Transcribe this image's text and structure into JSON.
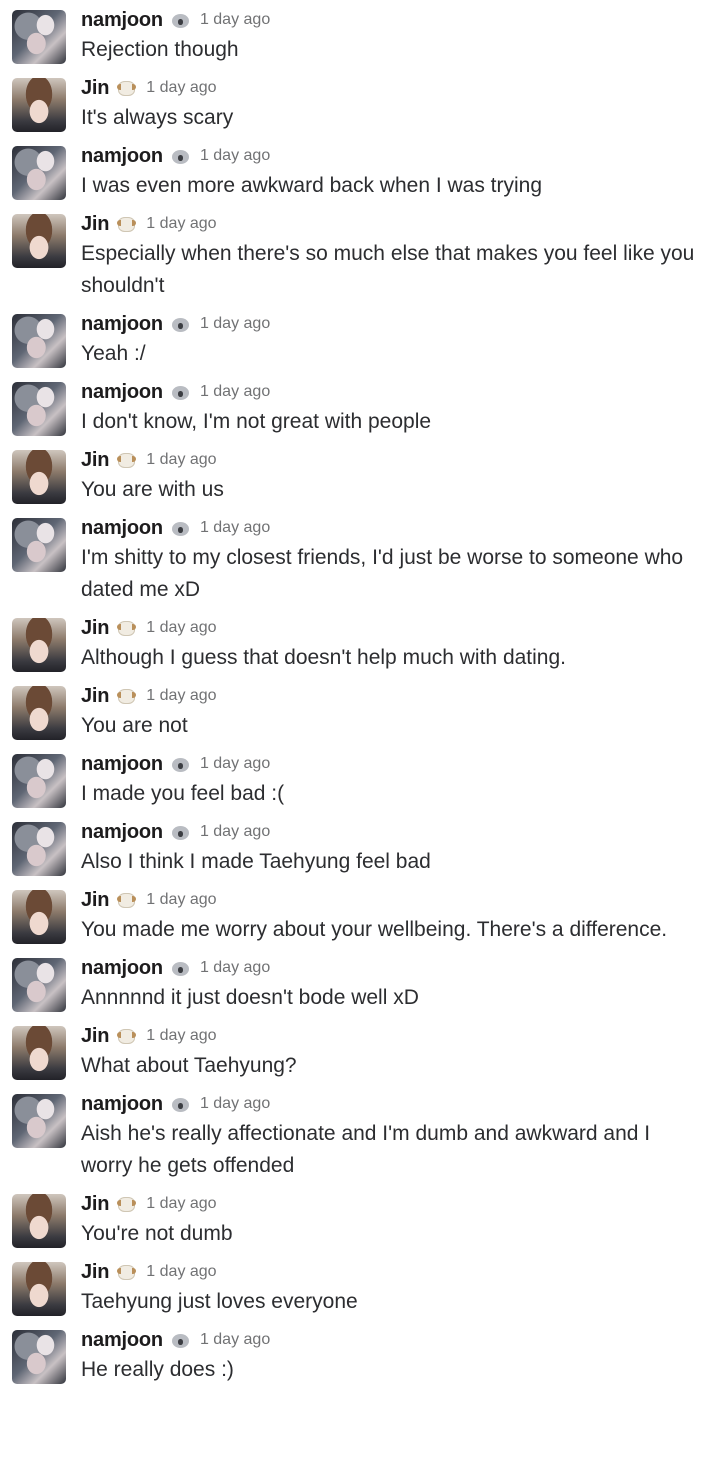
{
  "users": {
    "namjoon": {
      "name": "namjoon",
      "emoji": "koala-icon"
    },
    "jin": {
      "name": "Jin",
      "emoji": "sheep-icon"
    }
  },
  "messages": [
    {
      "user": "namjoon",
      "name": "namjoon",
      "time": "1 day ago",
      "text": "Rejection though"
    },
    {
      "user": "jin",
      "name": "Jin",
      "time": "1 day ago",
      "text": "It's always scary"
    },
    {
      "user": "namjoon",
      "name": "namjoon",
      "time": "1 day ago",
      "text": "I was even more awkward back when I was trying"
    },
    {
      "user": "jin",
      "name": "Jin",
      "time": "1 day ago",
      "text": "Especially when there's so much else that makes you feel like you shouldn't"
    },
    {
      "user": "namjoon",
      "name": "namjoon",
      "time": "1 day ago",
      "text": "Yeah :/"
    },
    {
      "user": "namjoon",
      "name": "namjoon",
      "time": "1 day ago",
      "text": "I don't know, I'm not great with people"
    },
    {
      "user": "jin",
      "name": "Jin",
      "time": "1 day ago",
      "text": "You are with us"
    },
    {
      "user": "namjoon",
      "name": "namjoon",
      "time": "1 day ago",
      "text": "I'm shitty to my closest friends, I'd just be worse to someone who dated me xD"
    },
    {
      "user": "jin",
      "name": "Jin",
      "time": "1 day ago",
      "text": "Although I guess that doesn't help much with dating."
    },
    {
      "user": "jin",
      "name": "Jin",
      "time": "1 day ago",
      "text": "You are not"
    },
    {
      "user": "namjoon",
      "name": "namjoon",
      "time": "1 day ago",
      "text": "I made you feel bad :("
    },
    {
      "user": "namjoon",
      "name": "namjoon",
      "time": "1 day ago",
      "text": "Also I think I made Taehyung feel bad"
    },
    {
      "user": "jin",
      "name": "Jin",
      "time": "1 day ago",
      "text": "You made me worry about your wellbeing. There's a difference."
    },
    {
      "user": "namjoon",
      "name": "namjoon",
      "time": "1 day ago",
      "text": "Annnnnd it just doesn't bode well xD"
    },
    {
      "user": "jin",
      "name": "Jin",
      "time": "1 day ago",
      "text": "What about Taehyung?"
    },
    {
      "user": "namjoon",
      "name": "namjoon",
      "time": "1 day ago",
      "text": "Aish he's really affectionate and I'm dumb and awkward and I worry he gets offended"
    },
    {
      "user": "jin",
      "name": "Jin",
      "time": "1 day ago",
      "text": "You're not dumb"
    },
    {
      "user": "jin",
      "name": "Jin",
      "time": "1 day ago",
      "text": "Taehyung just loves everyone"
    },
    {
      "user": "namjoon",
      "name": "namjoon",
      "time": "1 day ago",
      "text": "He really does :)"
    }
  ]
}
